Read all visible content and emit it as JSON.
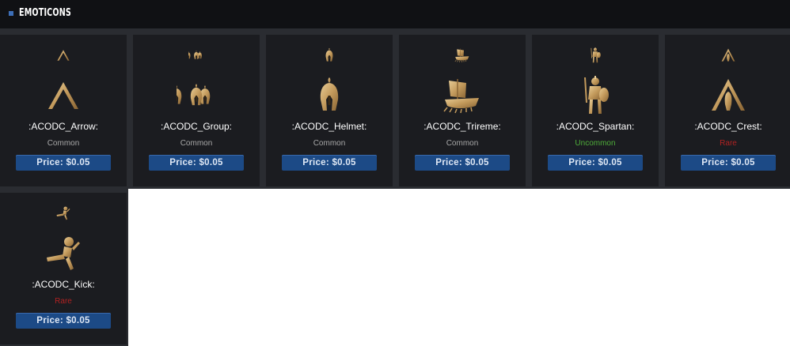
{
  "header": {
    "title": "EMOTICONS"
  },
  "colors": {
    "common": "#a9a9a9",
    "uncommon": "#4fae3a",
    "rare": "#b22222",
    "gold": "#c9a46a"
  },
  "items": [
    {
      "name": ":ACODC_Arrow:",
      "rarity": "Common",
      "rarity_level": "common",
      "price": "Price: $0.05",
      "icon": "arrow-chevron-icon"
    },
    {
      "name": ":ACODC_Group:",
      "rarity": "Common",
      "rarity_level": "common",
      "price": "Price: $0.05",
      "icon": "spartan-group-icon"
    },
    {
      "name": ":ACODC_Helmet:",
      "rarity": "Common",
      "rarity_level": "common",
      "price": "Price: $0.05",
      "icon": "spartan-helmet-icon"
    },
    {
      "name": ":ACODC_Trireme:",
      "rarity": "Common",
      "rarity_level": "common",
      "price": "Price: $0.05",
      "icon": "trireme-ship-icon"
    },
    {
      "name": ":ACODC_Spartan:",
      "rarity": "Uncommon",
      "rarity_level": "uncommon",
      "price": "Price: $0.05",
      "icon": "spartan-warrior-icon"
    },
    {
      "name": ":ACODC_Crest:",
      "rarity": "Rare",
      "rarity_level": "rare",
      "price": "Price: $0.05",
      "icon": "crest-icon"
    },
    {
      "name": ":ACODC_Kick:",
      "rarity": "Rare",
      "rarity_level": "rare",
      "price": "Price: $0.05",
      "icon": "spartan-kick-icon"
    }
  ]
}
